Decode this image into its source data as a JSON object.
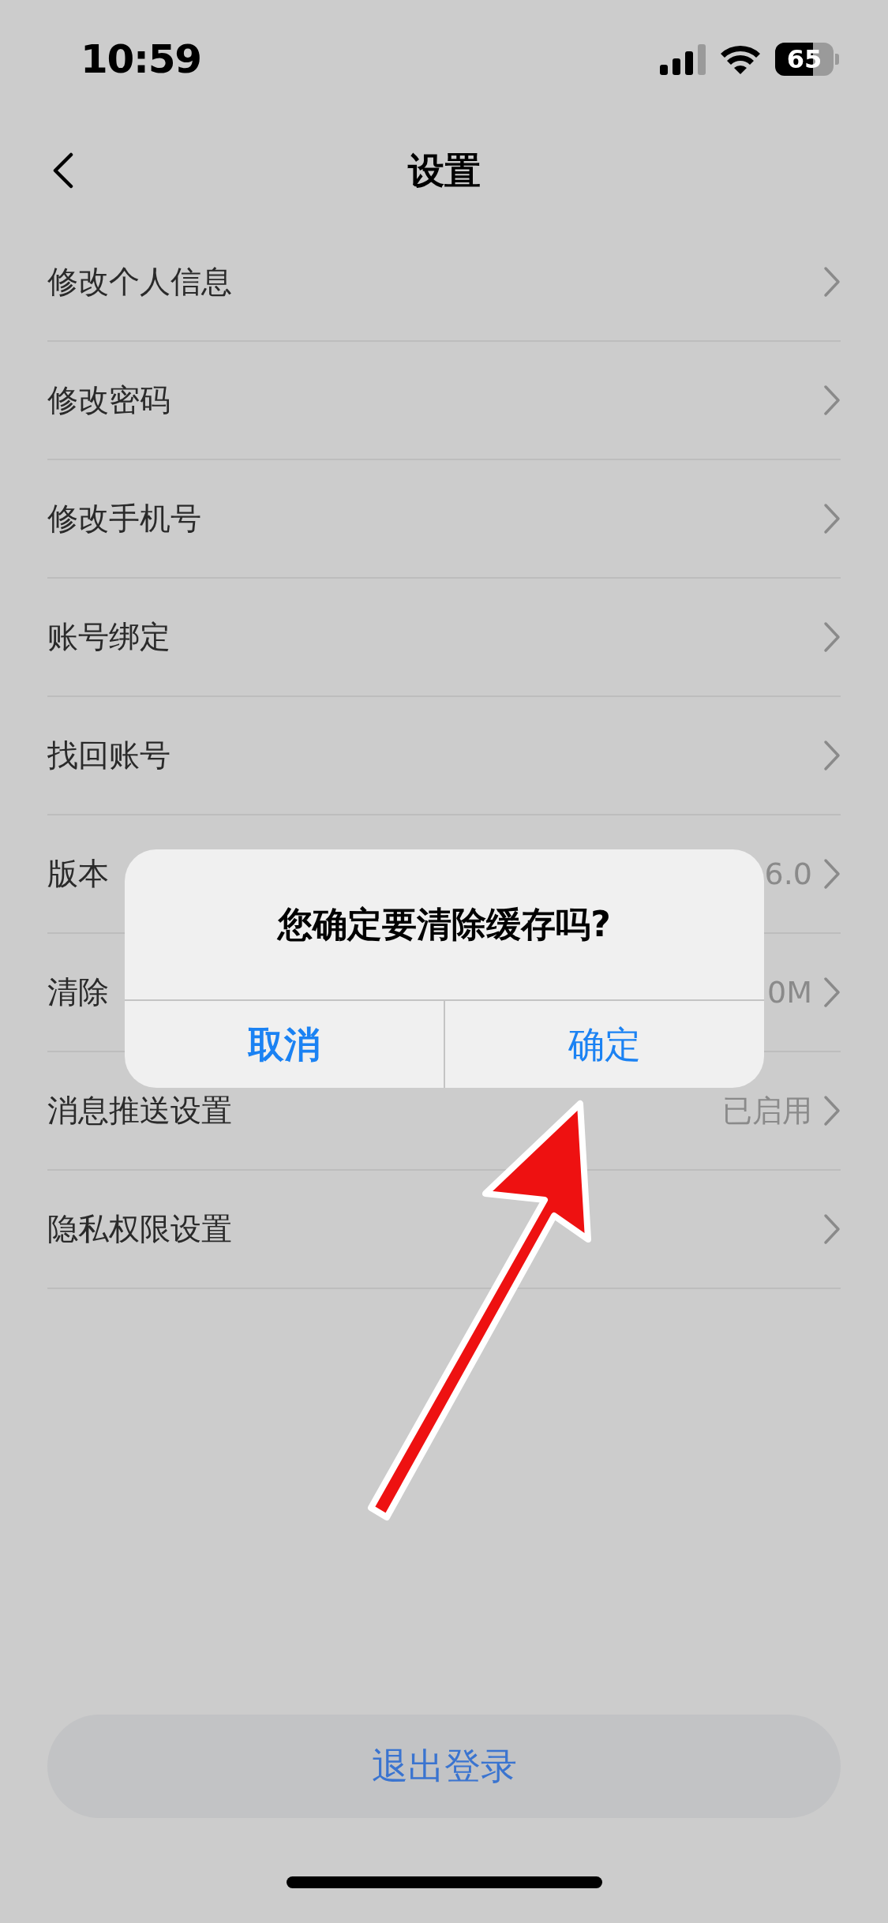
{
  "status_bar": {
    "time": "10:59",
    "battery": "65"
  },
  "nav": {
    "title": "设置"
  },
  "rows": [
    {
      "label": "修改个人信息"
    },
    {
      "label": "修改密码"
    },
    {
      "label": "修改手机号"
    },
    {
      "label": "账号绑定"
    },
    {
      "label": "找回账号"
    },
    {
      "label": "版本",
      "value": "6.0"
    },
    {
      "label": "清除",
      "value": "0M"
    },
    {
      "label": "消息推送设置",
      "value": "已启用"
    },
    {
      "label": "隐私权限设置"
    }
  ],
  "dialog": {
    "title": "您确定要清除缓存吗?",
    "buttons": [
      {
        "label": "取消",
        "kind": "cancel"
      },
      {
        "label": "确定",
        "kind": "confirm"
      }
    ]
  },
  "logout_button": "退出登录"
}
